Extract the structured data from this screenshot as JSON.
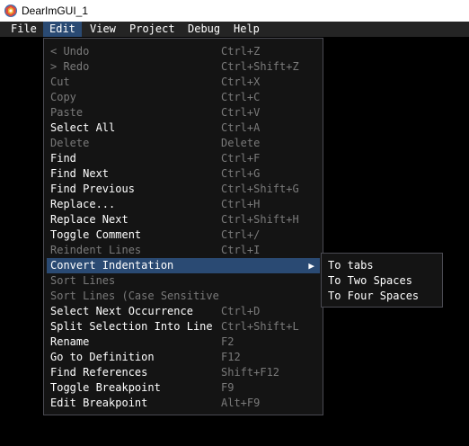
{
  "window": {
    "title": "DearImGUI_1"
  },
  "menubar": {
    "items": [
      "File",
      "Edit",
      "View",
      "Project",
      "Debug",
      "Help"
    ]
  },
  "edit_menu": {
    "items": [
      {
        "label": "< Undo",
        "shortcut": "Ctrl+Z",
        "enabled": false
      },
      {
        "label": "> Redo",
        "shortcut": "Ctrl+Shift+Z",
        "enabled": false
      },
      {
        "label": "Cut",
        "shortcut": "Ctrl+X",
        "enabled": false
      },
      {
        "label": "Copy",
        "shortcut": "Ctrl+C",
        "enabled": false
      },
      {
        "label": "Paste",
        "shortcut": "Ctrl+V",
        "enabled": false
      },
      {
        "label": "Select All",
        "shortcut": "Ctrl+A",
        "enabled": true
      },
      {
        "label": "Delete",
        "shortcut": "Delete",
        "enabled": false
      },
      {
        "label": "Find",
        "shortcut": "Ctrl+F",
        "enabled": true
      },
      {
        "label": "Find Next",
        "shortcut": "Ctrl+G",
        "enabled": true
      },
      {
        "label": "Find Previous",
        "shortcut": "Ctrl+Shift+G",
        "enabled": true
      },
      {
        "label": "Replace...",
        "shortcut": "Ctrl+H",
        "enabled": true
      },
      {
        "label": "Replace Next",
        "shortcut": "Ctrl+Shift+H",
        "enabled": true
      },
      {
        "label": "Toggle Comment",
        "shortcut": "Ctrl+/",
        "enabled": true
      },
      {
        "label": "Reindent Lines",
        "shortcut": "Ctrl+I",
        "enabled": false
      },
      {
        "label": "Convert Indentation",
        "shortcut": "",
        "enabled": true,
        "submenu": true,
        "highlighted": true
      },
      {
        "label": "Sort Lines",
        "shortcut": "",
        "enabled": false
      },
      {
        "label": "Sort Lines (Case Sensitive",
        "shortcut": "",
        "enabled": false
      },
      {
        "label": "Select Next Occurrence",
        "shortcut": "Ctrl+D",
        "enabled": true
      },
      {
        "label": "Split Selection Into Line",
        "shortcut": "Ctrl+Shift+L",
        "enabled": true
      },
      {
        "label": "Rename",
        "shortcut": "F2",
        "enabled": true
      },
      {
        "label": "Go to Definition",
        "shortcut": "F12",
        "enabled": true
      },
      {
        "label": "Find References",
        "shortcut": "Shift+F12",
        "enabled": true
      },
      {
        "label": "Toggle Breakpoint",
        "shortcut": "F9",
        "enabled": true
      },
      {
        "label": "Edit Breakpoint",
        "shortcut": "Alt+F9",
        "enabled": true
      }
    ]
  },
  "indent_submenu": {
    "items": [
      "To tabs",
      "To Two Spaces",
      "To Four Spaces"
    ]
  },
  "icons": {
    "submenu_arrow": "▶"
  },
  "colors": {
    "highlight": "#2a4a73",
    "menubar_bg": "#242424",
    "popup_bg": "#141414",
    "popup_border": "#4a4a52",
    "disabled_text": "#7a7a7a"
  }
}
